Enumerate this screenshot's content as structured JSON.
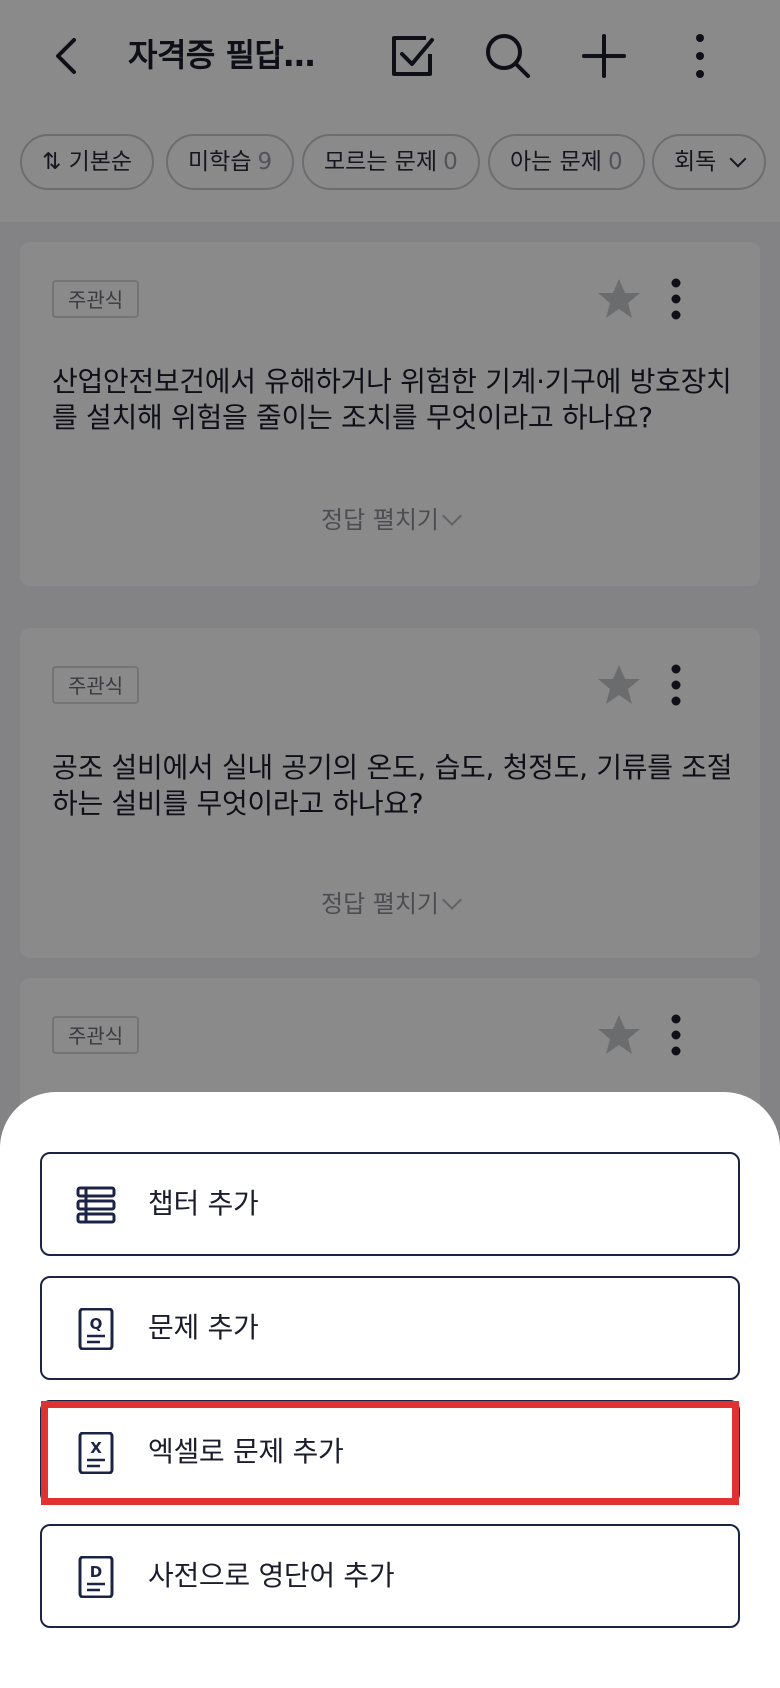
{
  "header": {
    "title": "자격증 필답…",
    "back_icon": "back-arrow-icon",
    "actions": [
      "checkbox-icon",
      "search-icon",
      "plus-icon",
      "more-vertical-icon"
    ]
  },
  "filters": {
    "sort_label": "기본순",
    "unlearned_label": "미학습",
    "unlearned_count": "9",
    "unknown_label": "모르는 문제",
    "unknown_count": "0",
    "known_label": "아는 문제",
    "known_count": "0",
    "mode_label": "회독"
  },
  "cards": [
    {
      "tag": "주관식",
      "question": "산업안전보건에서 유해하거나 위험한 기계·기구에 방호장치를 설치해 위험을 줄이는 조치를 무엇이라고 하나요?",
      "reveal": "정답 펼치기"
    },
    {
      "tag": "주관식",
      "question": "공조 설비에서 실내 공기의 온도, 습도, 청정도, 기류를 조절하는 설비를 무엇이라고 하나요?",
      "reveal": "정답 펼치기"
    },
    {
      "tag": "주관식"
    }
  ],
  "sheet": {
    "options": [
      {
        "label": "챕터 추가",
        "icon": "chapter-list-icon"
      },
      {
        "label": "문제 추가",
        "icon": "question-doc-icon"
      },
      {
        "label": "엑셀로 문제 추가",
        "icon": "excel-doc-icon"
      },
      {
        "label": "사전으로 영단어 추가",
        "icon": "dictionary-doc-icon"
      }
    ]
  },
  "colors": {
    "dim_overlay": "#000000",
    "option_border": "#1c2446",
    "highlight": "#e03232"
  }
}
